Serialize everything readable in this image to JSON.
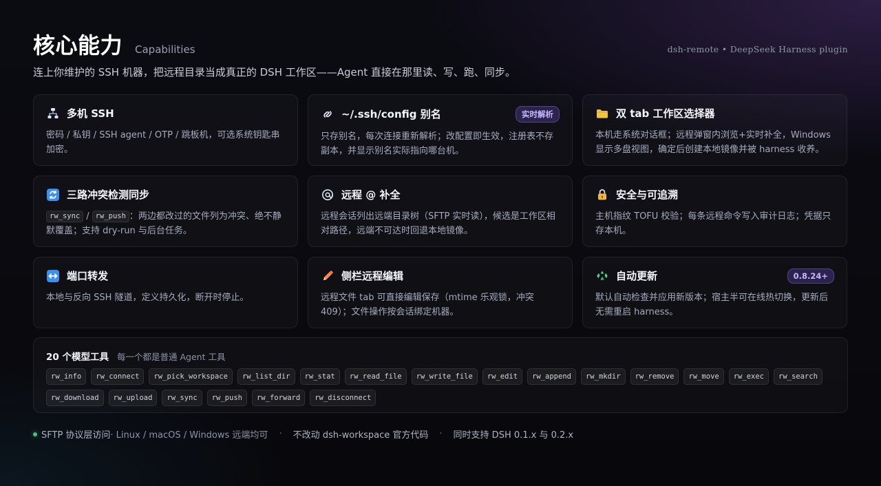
{
  "header": {
    "title": "核心能力",
    "title_en": "Capabilities",
    "subtitle": "连上你维护的 SSH 机器，把远程目录当成真正的 DSH 工作区——Agent 直接在那里读、写、跑、同步。",
    "meta": "dsh-remote • DeepSeek Harness plugin"
  },
  "cards": [
    {
      "icon": "network-icon",
      "title": "多机 SSH",
      "desc": "密码 / 私钥 / SSH agent / OTP / 跳板机，可选系统钥匙串加密。"
    },
    {
      "icon": "link-icon",
      "title": "~/.ssh/config 别名",
      "badge": "实时解析",
      "desc": "只存别名，每次连接重新解析；改配置即生效，注册表不存副本，并显示别名实际指向哪台机。"
    },
    {
      "icon": "folder-icon",
      "title": "双 tab 工作区选择器",
      "desc": "本机走系统对话框；远程弹窗内浏览+实时补全，Windows 显示多盘视图，确定后创建本地镜像并被 harness 收养。"
    },
    {
      "icon": "sync-icon",
      "title": "三路冲突检测同步",
      "chips": [
        "rw_sync",
        "rw_push"
      ],
      "desc_after": "：两边都改过的文件列为冲突、绝不静默覆盖；支持 dry-run 与后台任务。"
    },
    {
      "icon": "at-icon",
      "title": "远程 @ 补全",
      "desc": "远程会话列出远端目录树（SFTP 实时读），候选是工作区相对路径，远端不可达时回退本地镜像。"
    },
    {
      "icon": "lock-icon",
      "title": "安全与可追溯",
      "desc": "主机指纹 TOFU 校验；每条远程命令写入审计日志；凭据只存本机。"
    },
    {
      "icon": "port-icon",
      "title": "端口转发",
      "desc": "本地与反向 SSH 隧道，定义持久化，断开时停止。"
    },
    {
      "icon": "pencil-icon",
      "title": "侧栏远程编辑",
      "desc": "远程文件 tab 可直接编辑保存（mtime 乐观锁，冲突 409）；文件操作按会话绑定机器。"
    },
    {
      "icon": "recycle-icon",
      "title": "自动更新",
      "badge": "0.8.24+",
      "desc": "默认自动检查并应用新版本；宿主半可在线热切换，更新后无需重启 harness。"
    }
  ],
  "tools": {
    "title": "20 个模型工具",
    "subtitle": "每一个都是普通 Agent 工具",
    "items": [
      "rw_info",
      "rw_connect",
      "rw_pick_workspace",
      "rw_list_dir",
      "rw_stat",
      "rw_read_file",
      "rw_write_file",
      "rw_edit",
      "rw_append",
      "rw_mkdir",
      "rw_remove",
      "rw_move",
      "rw_exec",
      "rw_search",
      "rw_download",
      "rw_upload",
      "rw_sync",
      "rw_push",
      "rw_forward",
      "rw_disconnect"
    ]
  },
  "footer": {
    "item1": "SFTP 协议层访问",
    "item1_muted": " · Linux / macOS / Windows 远端均可",
    "sep": "·",
    "item2": "不改动 dsh-workspace 官方代码",
    "item3": "同时支持 DSH 0.1.x 与 0.2.x"
  },
  "colors": {
    "background": "#08080c",
    "accent_purple": "#7b5cf1",
    "badge_text": "#c5b6ff",
    "status_green": "#4bc17d"
  }
}
